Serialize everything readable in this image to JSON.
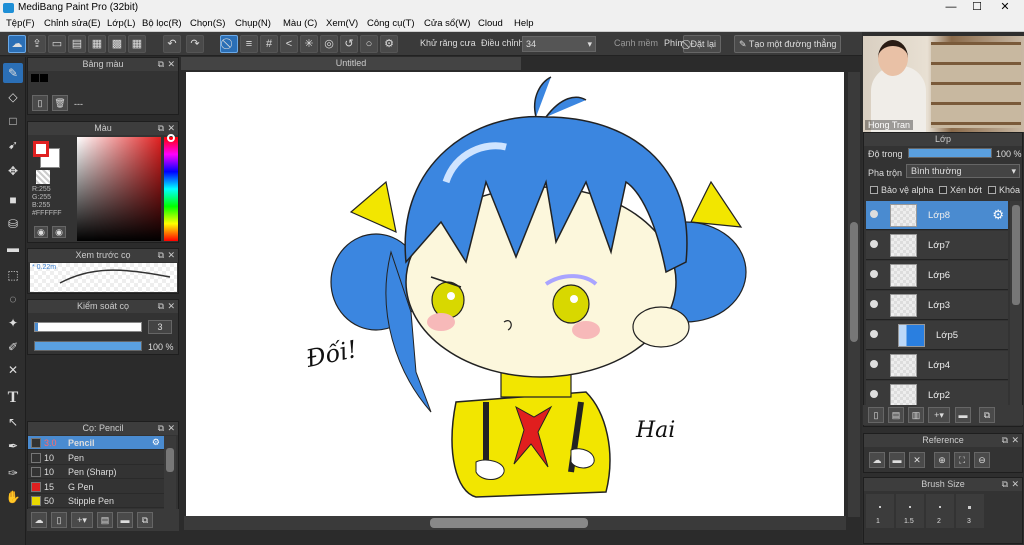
{
  "window": {
    "title": "MediBang Paint Pro (32bit)",
    "minimize": "—",
    "maximize": "☐",
    "close": "✕"
  },
  "menu": [
    "Tệp(F)",
    "Chỉnh sửa(E)",
    "Lớp(L)",
    "Bộ lọc(R)",
    "Chọn(S)",
    "Chụp(N)",
    "Màu (C)",
    "Xem(V)",
    "Công cụ(T)",
    "Cửa sổ(W)",
    "Cloud",
    "Help"
  ],
  "toolbar": {
    "antialias_label": "Khử răng cưa",
    "adjust_label": "Điều chỉnh",
    "adjust_value": "34",
    "edge_label": "Cạnh mềm",
    "keys_label": "Phím",
    "reset_button": "Đặt lại",
    "straight_line_button": "Tạo một đường thẳng"
  },
  "panels": {
    "palette": {
      "title": "Bảng màu",
      "text": "---"
    },
    "color": {
      "title": "Màu",
      "r": "R:255",
      "g": "G:255",
      "b": "B:255",
      "hex": "#FFFFFF",
      "primary_color": "#e02020"
    },
    "preview": {
      "title": "Xem trước cọ",
      "size": "0.22m"
    },
    "brush_control": {
      "title": "Kiểm soát cọ",
      "size_value": "3",
      "opacity_value": "100 %",
      "opacity": 1.0
    },
    "brush_list": {
      "title": "Cọ: Pencil",
      "items": [
        {
          "size": "3.0",
          "name": "Pencil",
          "color": "#333333",
          "selected": true
        },
        {
          "size": "10",
          "name": "Pen",
          "color": "#333333"
        },
        {
          "size": "10",
          "name": "Pen (Sharp)",
          "color": "#333333"
        },
        {
          "size": "15",
          "name": "G Pen",
          "color": "#e02020"
        },
        {
          "size": "50",
          "name": "Stipple Pen",
          "color": "#e8d800"
        }
      ]
    },
    "layers": {
      "title": "Lớp",
      "opacity_label": "Độ trong",
      "opacity_value": "100 %",
      "blend_label": "Pha trộn",
      "blend_value": "Bình thường",
      "protect_alpha": "Bảo vệ alpha",
      "clipping": "Xén bớt",
      "lock": "Khóa",
      "items": [
        {
          "name": "Lớp8",
          "selected": true
        },
        {
          "name": "Lớp7"
        },
        {
          "name": "Lớp6"
        },
        {
          "name": "Lớp3"
        },
        {
          "name": "Lớp5",
          "folder": true
        },
        {
          "name": "Lớp4"
        },
        {
          "name": "Lớp2"
        }
      ]
    },
    "reference": {
      "title": "Reference"
    },
    "brush_size": {
      "title": "Brush Size",
      "sizes": [
        "1",
        "1.5",
        "2",
        "3"
      ]
    }
  },
  "canvas": {
    "tab": "Untitled",
    "signature_left": "Đối!",
    "signature_right": "Hai"
  },
  "webcam": {
    "name": "Hong Tran"
  }
}
